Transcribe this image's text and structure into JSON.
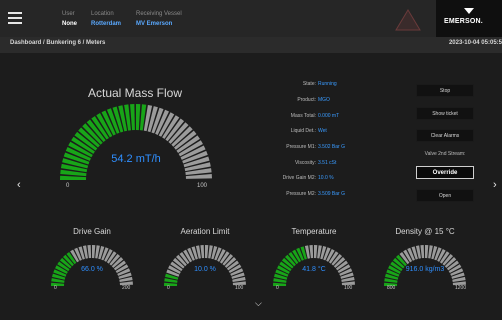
{
  "context": {
    "user_label": "User",
    "user_value": "None",
    "location_label": "Location",
    "location_value": "Rotterdam",
    "vessel_label": "Receiving Vessel",
    "vessel_value": "MV Emerson"
  },
  "brand": {
    "name": "EMERSON."
  },
  "breadcrumb": "Dashboard / Bunkering 6 / Meters",
  "datetime": "2023-10-04 05:05:5",
  "main_gauge": {
    "title": "Actual Mass Flow",
    "value": "54.2 mT/h",
    "min": "0",
    "max": "100",
    "level": 0.54
  },
  "info": [
    {
      "key": "State:",
      "value": "Running"
    },
    {
      "key": "Product:",
      "value": "MGO"
    },
    {
      "key": "Mass Total:",
      "value": "0.000 mT"
    },
    {
      "key": "Liquid Det.:",
      "value": "Wet"
    },
    {
      "key": "Pressure M1:",
      "value": "3.502 Bar G"
    },
    {
      "key": "Viscosity:",
      "value": "3.51 cSt"
    },
    {
      "key": "Drive Gain M2:",
      "value": "10.0 %"
    },
    {
      "key": "Pressure M2:",
      "value": "3.509 Bar G"
    }
  ],
  "buttons": {
    "stop": "Stop",
    "show_ticket": "Show ticket",
    "clear_alarms": "Clear Alarms",
    "valve_label": "Valve 2nd Stream:",
    "override": "Override",
    "open": "Open"
  },
  "small_gauges": [
    {
      "title": "Drive Gain",
      "value": "66.0 %",
      "min": "0",
      "max": "200",
      "level": 0.33
    },
    {
      "title": "Aeration Limit",
      "value": "10.0 %",
      "min": "0",
      "max": "100",
      "level": 0.1
    },
    {
      "title": "Temperature",
      "value": "41.8 °C",
      "min": "0",
      "max": "100",
      "level": 0.418
    },
    {
      "title": "Density @ 15 °C",
      "value": "916.0 kg/m3",
      "min": "800",
      "max": "1200",
      "level": 0.29
    }
  ],
  "colors": {
    "fill": "#18a518",
    "track": "#9b9b9b",
    "value": "#2f8fff",
    "highlight": "#3a9bff"
  },
  "icons": {
    "menu": "hamburger-icon",
    "warning": "warning-triangle-icon",
    "prev": "chevron-left-icon",
    "next": "chevron-right-icon",
    "down": "chevron-down-icon"
  }
}
